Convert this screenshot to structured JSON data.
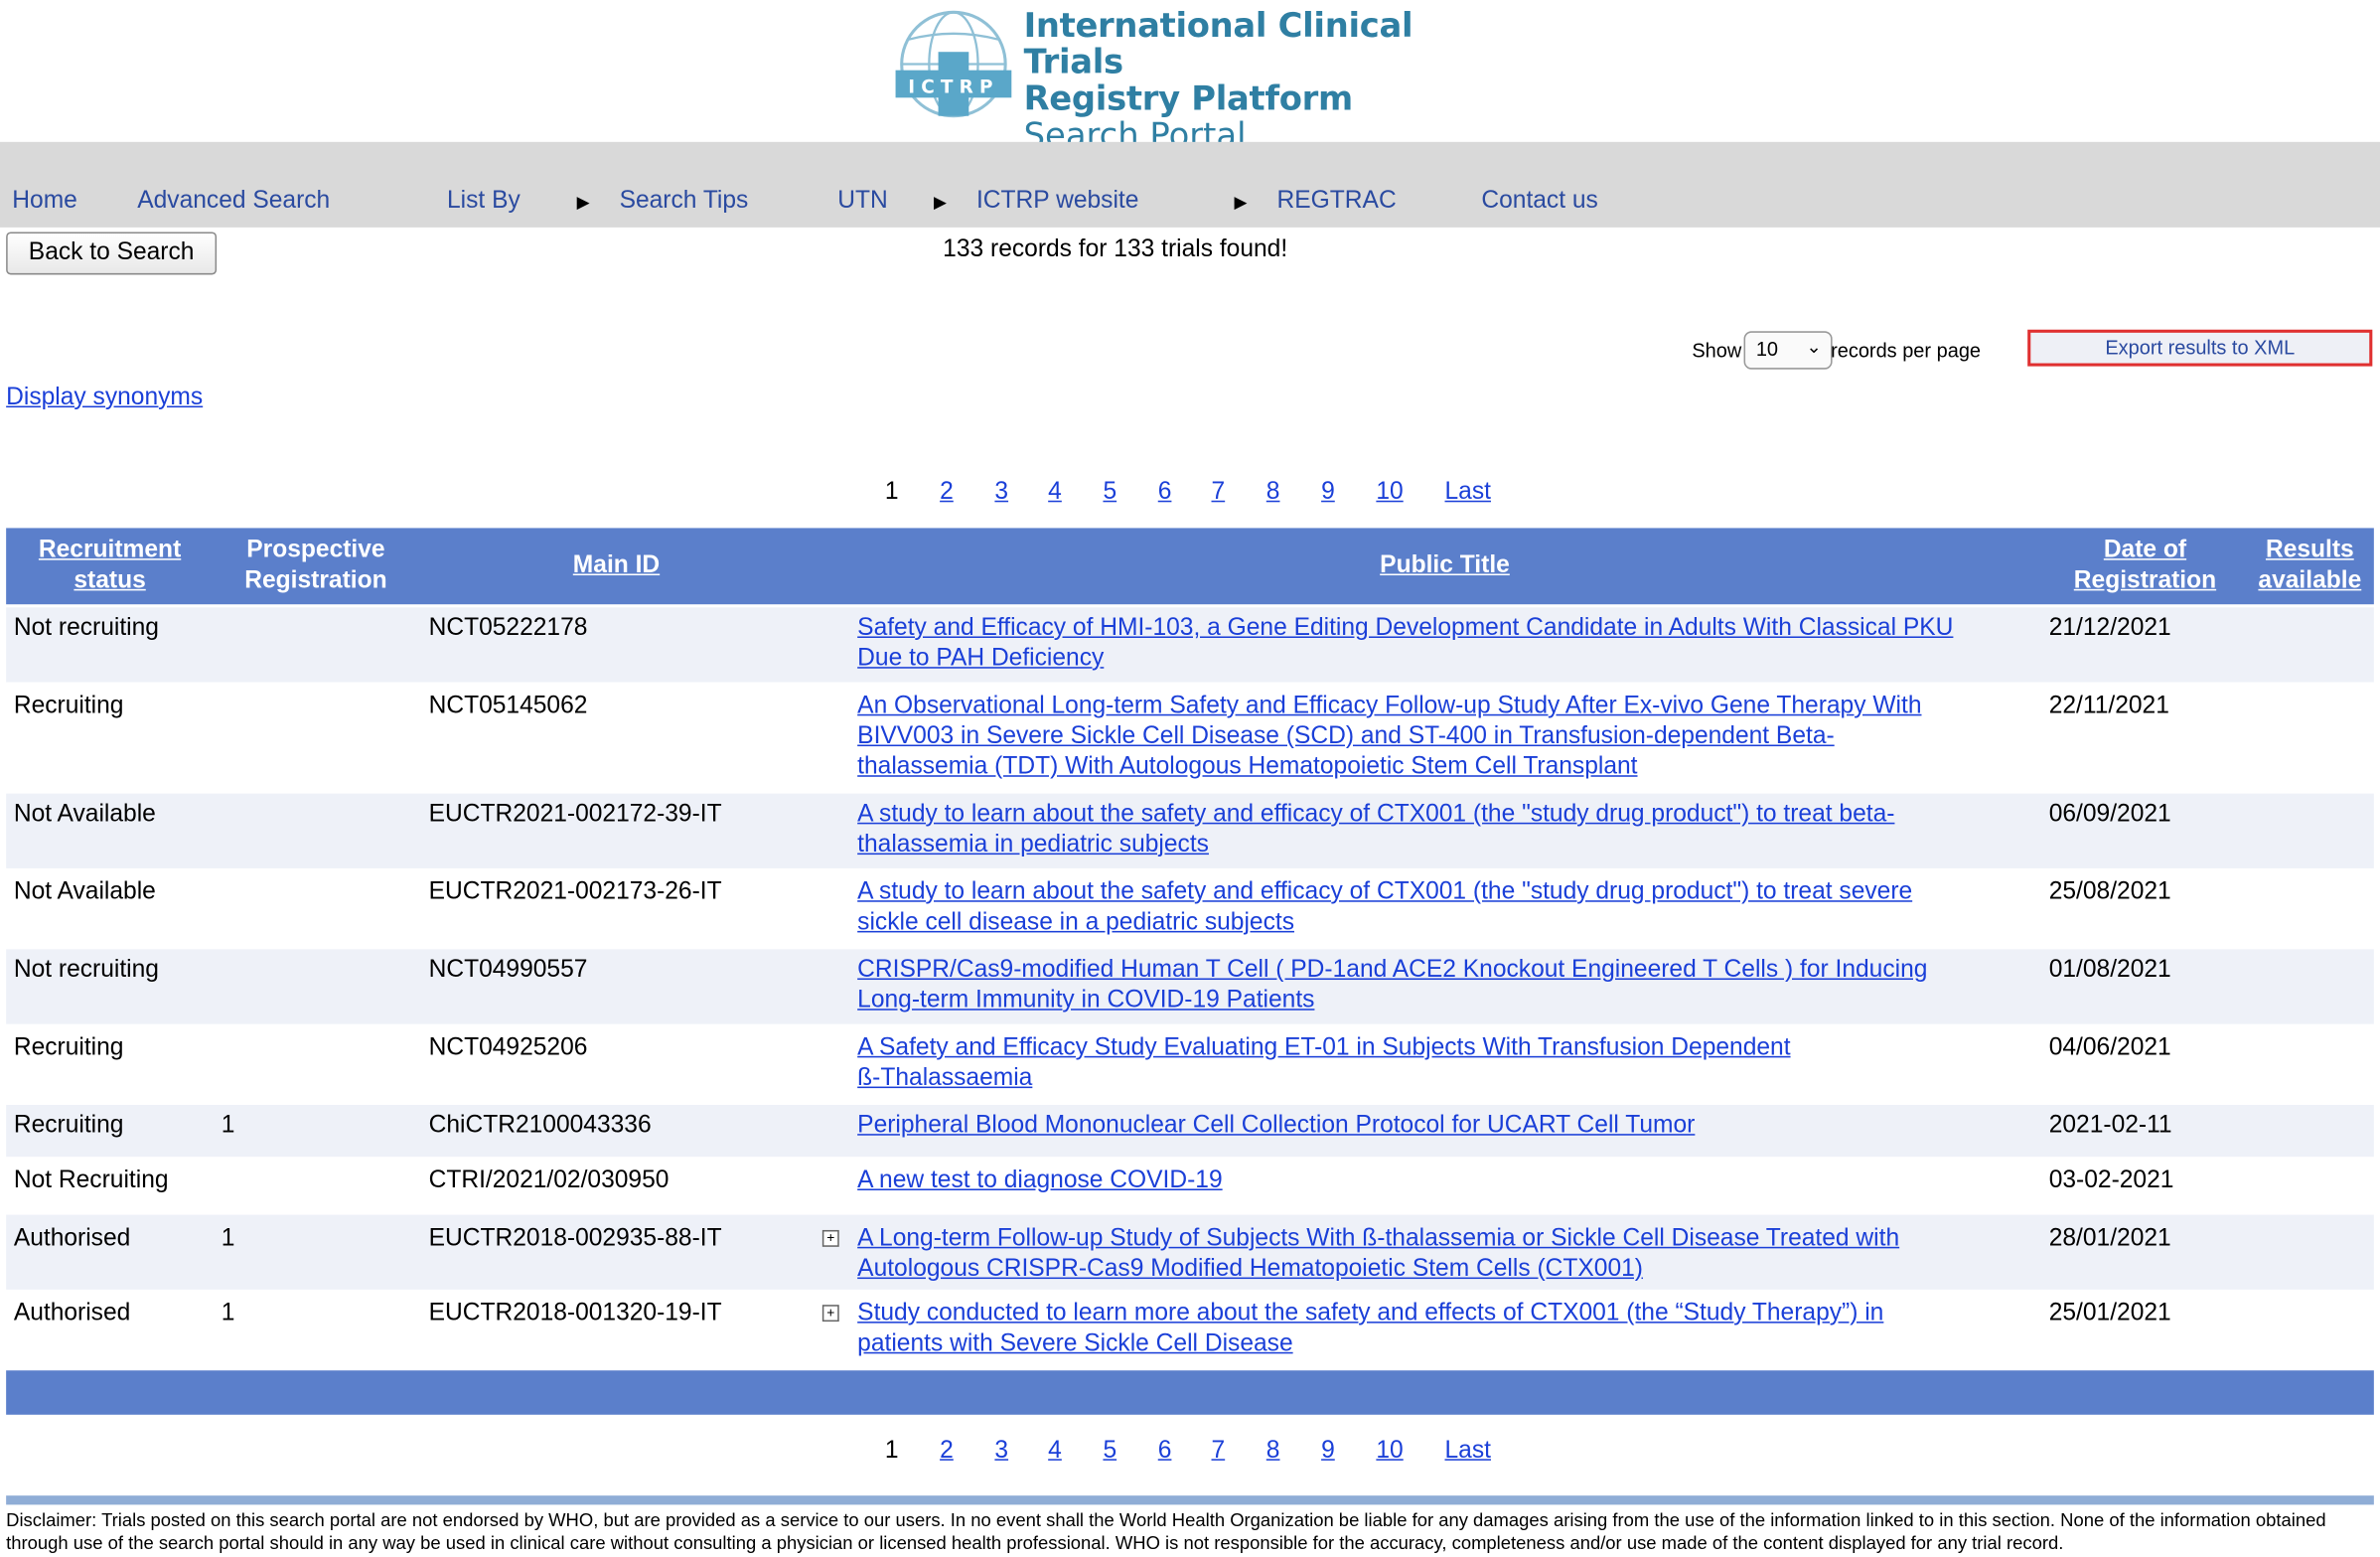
{
  "header": {
    "logo_badge": "ICTRP",
    "title_line1": "International Clinical Trials",
    "title_line2": "Registry Platform",
    "title_line3": "Search Portal"
  },
  "nav": {
    "home": "Home",
    "advanced_search": "Advanced Search",
    "list_by": "List By",
    "search_tips": "Search Tips",
    "utn": "UTN",
    "ictrp_website": "ICTRP website",
    "regtrac": "REGTRAC",
    "contact_us": "Contact us"
  },
  "toolbar": {
    "back_label": "Back to Search",
    "found_text": "133 records for 133 trials found!",
    "show_label": "Show",
    "per_page_value": "10",
    "per_page_suffix": "records per page",
    "export_label": "Export results to XML",
    "synonyms_label": "Display synonyms"
  },
  "pager": {
    "current": "1",
    "pages": [
      "2",
      "3",
      "4",
      "5",
      "6",
      "7",
      "8",
      "9",
      "10"
    ],
    "last": "Last"
  },
  "table": {
    "headers": {
      "recruitment_line1": "Recruitment",
      "recruitment_line2": "status",
      "prospective_line1": "Prospective",
      "prospective_line2": "Registration",
      "main_id": "Main ID",
      "public_title": "Public Title",
      "date_line1": "Date of",
      "date_line2": "Registration",
      "results_line1": "Results",
      "results_line2": "available"
    },
    "rows": [
      {
        "status": "Not recruiting",
        "prospective": "",
        "main_id": "NCT05222178",
        "title_l1": "Safety and Efficacy of HMI-103, a Gene Editing Development Candidate in Adults With Classical PKU",
        "title_l2": "Due to PAH Deficiency",
        "title_l3": "",
        "date": "21/12/2021"
      },
      {
        "status": "Recruiting",
        "prospective": "",
        "main_id": "NCT05145062",
        "title_l1": "An Observational Long-term Safety and Efficacy Follow-up Study After Ex-vivo Gene Therapy With",
        "title_l2": "BIVV003 in Severe Sickle Cell Disease (SCD) and ST-400 in Transfusion-dependent Beta-",
        "title_l3": "thalassemia (TDT) With Autologous Hematopoietic Stem Cell Transplant",
        "date": "22/11/2021"
      },
      {
        "status": "Not Available",
        "prospective": "",
        "main_id": "EUCTR2021-002172-39-IT",
        "title_l1": "A study to learn about the safety and efficacy of CTX001 (the \"study drug product\") to treat beta-",
        "title_l2": "thalassemia in pediatric subjects",
        "title_l3": "",
        "date": "06/09/2021"
      },
      {
        "status": "Not Available",
        "prospective": "",
        "main_id": "EUCTR2021-002173-26-IT",
        "title_l1": "A study to learn about the safety and efficacy of CTX001 (the \"study drug product\") to treat severe",
        "title_l2": "sickle cell disease in a pediatric subjects",
        "title_l3": "",
        "date": "25/08/2021"
      },
      {
        "status": "Not recruiting",
        "prospective": "",
        "main_id": "NCT04990557",
        "title_l1": "CRISPR/Cas9-modified Human T Cell ( PD-1and ACE2 Knockout Engineered T Cells ) for Inducing",
        "title_l2": "Long-term Immunity in COVID-19 Patients",
        "title_l3": "",
        "date": "01/08/2021"
      },
      {
        "status": "Recruiting",
        "prospective": "",
        "main_id": "NCT04925206",
        "title_l1": "A Safety and Efficacy Study Evaluating ET-01 in Subjects With Transfusion Dependent",
        "title_l2": "ß-Thalassaemia",
        "title_l3": "",
        "date": "04/06/2021"
      },
      {
        "status": "Recruiting",
        "prospective": "1",
        "main_id": "ChiCTR2100043336",
        "title_l1": "Peripheral Blood Mononuclear Cell Collection Protocol for UCART Cell Tumor",
        "title_l2": "",
        "title_l3": "",
        "date": "2021-02-11"
      },
      {
        "status": "Not Recruiting",
        "prospective": "",
        "main_id": "CTRI/2021/02/030950",
        "title_l1": "A new test to diagnose COVID-19",
        "title_l2": "",
        "title_l3": "",
        "date": "03-02-2021"
      },
      {
        "status": "Authorised",
        "prospective": "1",
        "main_id": "EUCTR2018-002935-88-IT",
        "title_l1": "A Long-term Follow-up Study of Subjects With ß-thalassemia or Sickle Cell Disease Treated with",
        "title_l2": "Autologous CRISPR-Cas9 Modified Hematopoietic Stem Cells (CTX001)",
        "title_l3": "",
        "date": "28/01/2021"
      },
      {
        "status": "Authorised",
        "prospective": "1",
        "main_id": "EUCTR2018-001320-19-IT",
        "title_l1": "Study conducted to learn more about the safety and effects of CTX001 (the “Study Therapy”) in",
        "title_l2": "patients with Severe Sickle Cell Disease",
        "title_l3": "",
        "date": "25/01/2021"
      }
    ]
  },
  "footer": {
    "disclaimer": "Disclaimer: Trials posted on this search portal are not endorsed by WHO, but are provided as a service to our users. In no event shall the World Health Organization be liable for any damages arising from the use of the information linked to in this section. None of the information obtained through use of the search portal should in any way be used in clinical care without consulting a physician or licensed health professional. WHO is not responsible for the accuracy, completeness and/or use made of the content displayed for any trial record."
  },
  "colors": {
    "table_header": "#5b7fcb",
    "row_alt": "#eef1f8",
    "link": "#1a3fd8",
    "nav_link": "#2a4aa0",
    "nav_bg": "#d9d9d9",
    "logo": "#2f7fa3"
  }
}
